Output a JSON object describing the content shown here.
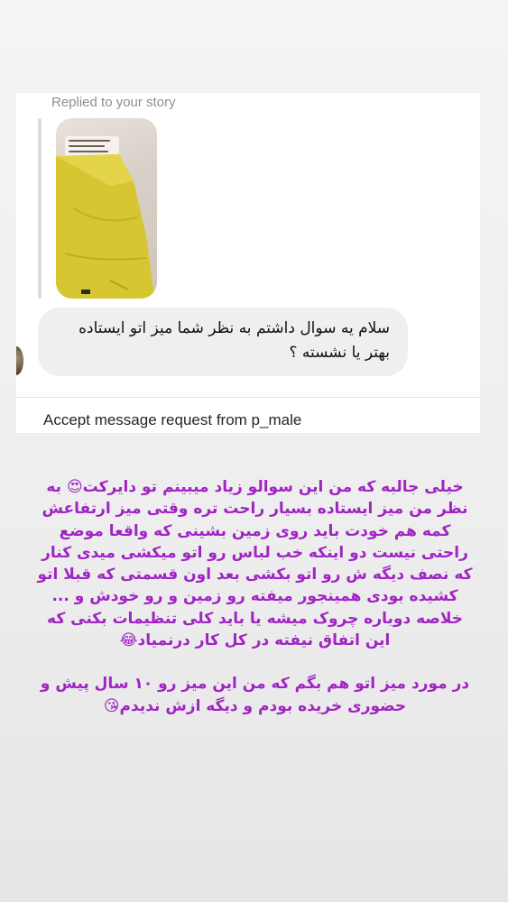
{
  "dm_screenshot": {
    "replied_label": "Replied to your story",
    "message": "سلام یه سوال داشتم به نظر شما میز اتو ایستاده بهتر یا نشسته ؟",
    "accept_request": "Accept message request from p_male"
  },
  "caption": {
    "paragraph1": "خیلی جالبه که من این سوالو زیاد میبینم تو دایرکت😍 به نظر من میز ایستاده بسیار راحت تره وقتی میز ارتفاعش کمه هم خودت باید روی زمین بشینی که واقعا موضع راحتی نیست دو اینکه خب لباس رو اتو میکشی میدی کنار که نصف دیگه ش رو اتو بکشی بعد اون قسمتی که قبلا اتو کشیده بودی همینجور میفته رو زمین و رو خودش و ... خلاصه دوباره چروک میشه یا باید کلی تنظیمات بکنی که این اتفاق نیفته در کل کار درنمیاد😂",
    "paragraph2": "در مورد میز اتو هم بگم که من این میز رو ۱۰ سال پیش و حضوری خریده بودم و دیگه ازش ندیدم😘"
  },
  "colors": {
    "caption_text": "#a024c4",
    "bubble_bg": "#efefef",
    "muted_text": "#8e8e8e"
  }
}
